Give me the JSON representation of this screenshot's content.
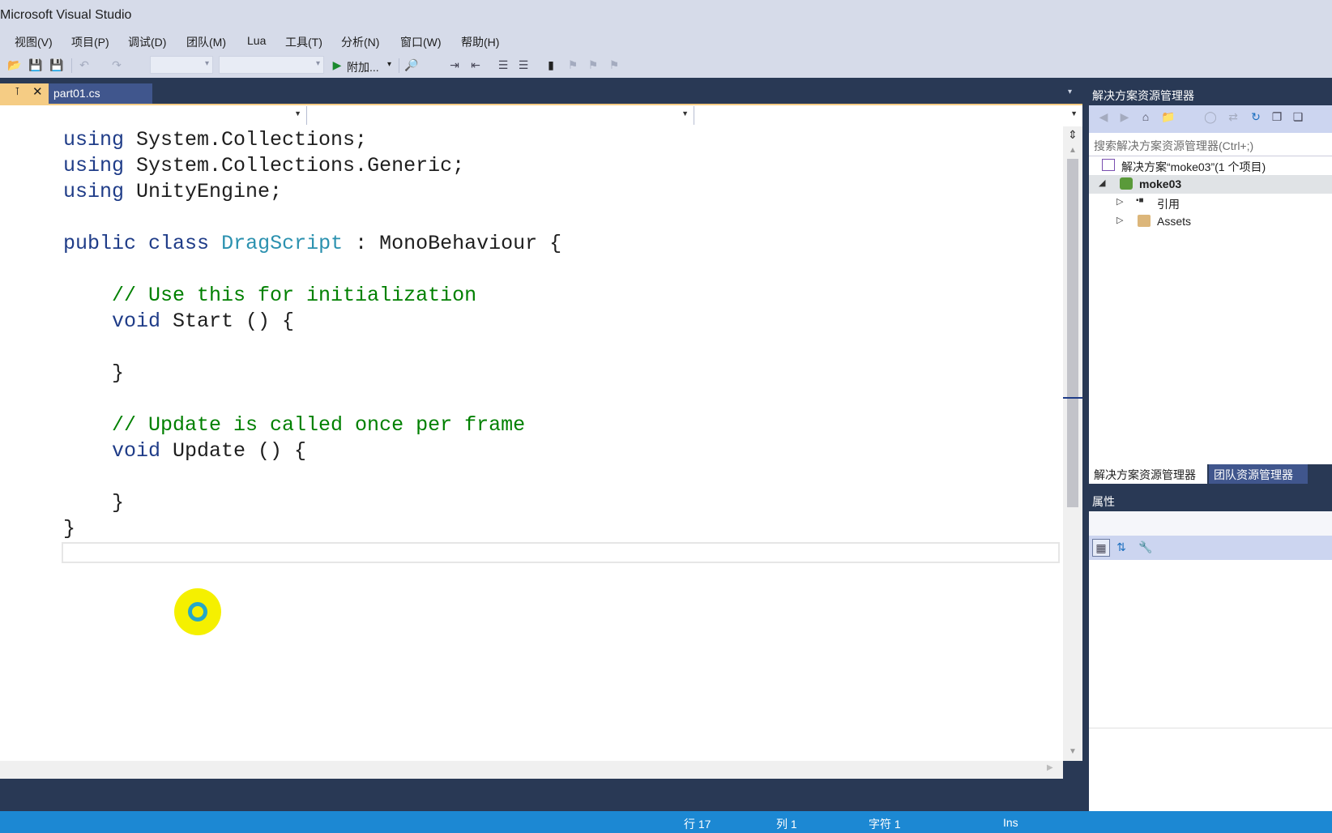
{
  "window": {
    "title": "Microsoft Visual Studio"
  },
  "menu": {
    "items": [
      "视图(V)",
      "项目(P)",
      "调试(D)",
      "团队(M)",
      "Lua",
      "工具(T)",
      "分析(N)",
      "窗口(W)",
      "帮助(H)"
    ]
  },
  "toolbar": {
    "start_label": "附加...",
    "icons": [
      "open-icon",
      "save-icon",
      "save-all-icon",
      "undo-icon",
      "redo-icon",
      "start-icon",
      "find-icon",
      "indent-icon",
      "outdent-icon",
      "bookmark-icon"
    ]
  },
  "editor": {
    "tab_label": "part01.cs",
    "lines": [
      [
        {
          "t": "using",
          "c": "kwdark"
        },
        {
          "t": " System.Collections;",
          "c": ""
        }
      ],
      [
        {
          "t": "using",
          "c": "kwdark"
        },
        {
          "t": " System.Collections.Generic;",
          "c": ""
        }
      ],
      [
        {
          "t": "using",
          "c": "kwdark"
        },
        {
          "t": " UnityEngine;",
          "c": ""
        }
      ],
      [],
      [
        {
          "t": "public",
          "c": "kwdark"
        },
        {
          "t": " ",
          "c": ""
        },
        {
          "t": "class",
          "c": "kwdark"
        },
        {
          "t": " ",
          "c": ""
        },
        {
          "t": "DragScript",
          "c": "typ"
        },
        {
          "t": " : MonoBehaviour {",
          "c": ""
        }
      ],
      [],
      [
        {
          "t": "    // Use this for initialization",
          "c": "cmt"
        }
      ],
      [
        {
          "t": "    ",
          "c": ""
        },
        {
          "t": "void",
          "c": "kwdark"
        },
        {
          "t": " Start () {",
          "c": ""
        }
      ],
      [],
      [
        {
          "t": "    }",
          "c": ""
        }
      ],
      [],
      [
        {
          "t": "    // Update is called once per frame",
          "c": "cmt"
        }
      ],
      [
        {
          "t": "    ",
          "c": ""
        },
        {
          "t": "void",
          "c": "kwdark"
        },
        {
          "t": " Update () {",
          "c": ""
        }
      ],
      [],
      [
        {
          "t": "    }",
          "c": ""
        }
      ],
      [
        {
          "t": "}",
          "c": ""
        }
      ],
      []
    ]
  },
  "solution_explorer": {
    "title": "解决方案资源管理器",
    "search_placeholder": "搜索解决方案资源管理器(Ctrl+;)",
    "solution_label": "解决方案“moke03”(1 个项目)",
    "project_label": "moke03",
    "references_label": "引用",
    "assets_label": "Assets",
    "tab_solution": "解决方案资源管理器",
    "tab_team": "团队资源管理器"
  },
  "properties": {
    "title": "属性"
  },
  "status": {
    "line": "行 17",
    "col": "列 1",
    "char": "字符 1",
    "mode": "Ins"
  },
  "colors": {
    "accent": "#1c88d3",
    "frame": "#293955",
    "tab_active": "#f5cc84"
  }
}
